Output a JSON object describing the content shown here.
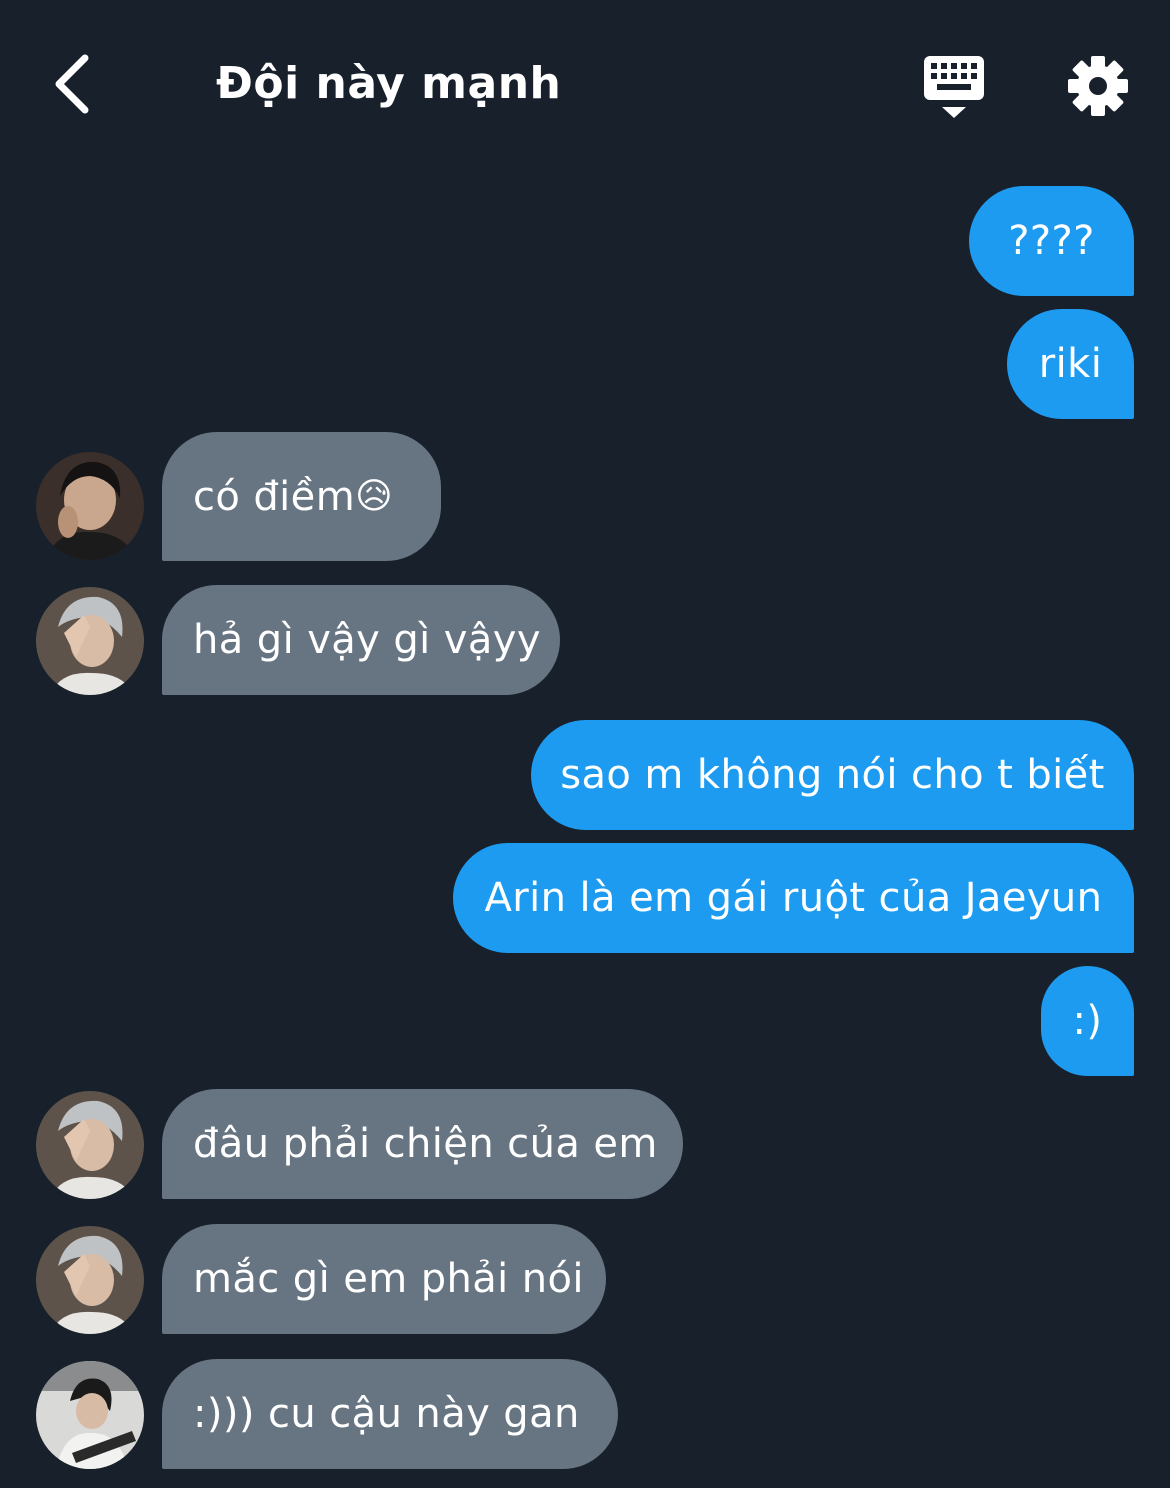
{
  "header": {
    "title": "Đội này mạnh",
    "back_icon": "chevron-left-icon",
    "keyboard_icon": "keyboard-icon",
    "settings_icon": "gear-icon"
  },
  "colors": {
    "background": "#17202b",
    "outgoing_bubble": "#1d9bf0",
    "incoming_bubble": "#677482",
    "text": "#ffffff"
  },
  "messages": [
    {
      "direction": "out",
      "text": "????"
    },
    {
      "direction": "out",
      "text": "riki"
    },
    {
      "direction": "in",
      "text": "có điềm",
      "emoji": "😥",
      "avatar": "avatar-1"
    },
    {
      "direction": "in",
      "text": "hả gì vậy gì vậyy",
      "avatar": "avatar-2"
    },
    {
      "direction": "out",
      "text": "sao m không nói cho t biết"
    },
    {
      "direction": "out",
      "text": "Arin là em gái ruột của Jaeyun"
    },
    {
      "direction": "out",
      "text": ":)"
    },
    {
      "direction": "in",
      "text": "đâu phải chiện của em",
      "avatar": "avatar-2"
    },
    {
      "direction": "in",
      "text": "mắc gì em phải nói",
      "avatar": "avatar-2"
    },
    {
      "direction": "in",
      "text": ":))) cu cậu này gan",
      "avatar": "avatar-3"
    }
  ]
}
